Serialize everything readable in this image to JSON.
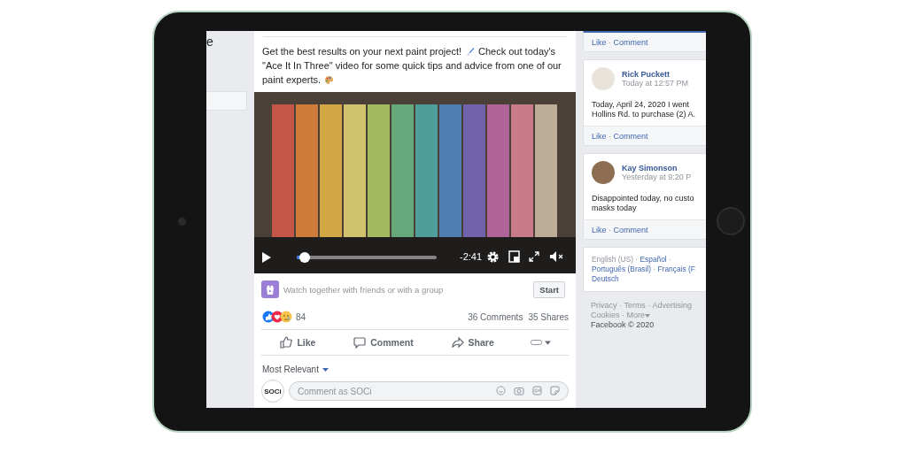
{
  "left_column": {
    "label": "e"
  },
  "separator": "·",
  "post": {
    "text_lines": [
      [
        {
          "kind": "text",
          "text": "Get the best results on your next paint project!"
        },
        {
          "kind": "brush"
        },
        {
          "kind": "text",
          "text": "Check out today's"
        }
      ],
      [
        {
          "kind": "text",
          "text": "\"Ace It In Three\" video for some quick tips and advice from one of our"
        }
      ],
      [
        {
          "kind": "text",
          "text": "paint experts."
        },
        {
          "kind": "palette"
        }
      ]
    ],
    "video": {
      "time": "-2:41",
      "progress": {
        "level": 0.06
      }
    },
    "watch_together": {
      "text": "Watch together with friends or with a group",
      "button": "Start"
    },
    "reactions": {
      "count": "84",
      "comments": "36 Comments",
      "shares": "35 Shares"
    },
    "actions": [
      {
        "kind": "like",
        "label": "Like"
      },
      {
        "kind": "comment",
        "label": "Comment"
      },
      {
        "kind": "share",
        "label": "Share"
      }
    ],
    "sort": {
      "label": "Most Relevant"
    },
    "comment_box": {
      "avatar": "SOCi",
      "placeholder": "Comment as SOCi"
    }
  },
  "reviews": [
    {
      "links": [
        "Like",
        "Comment"
      ]
    },
    {
      "name": "Rick Puckett",
      "time": "Today at 12:57 PM",
      "lines": [
        "Today, April 24, 2020 I went",
        "Hollins Rd. to purchase (2) A."
      ],
      "links": [
        "Like",
        "Comment"
      ]
    },
    {
      "name": "Kay Simonson",
      "time": "Yesterday at 9:20 P",
      "lines": [
        "Disappointed today, no custo",
        "masks today"
      ],
      "links": [
        "Like",
        "Comment"
      ]
    }
  ],
  "languages": [
    {
      "label": "English (US)",
      "kind": "current"
    },
    {
      "label": "Español",
      "kind": "link"
    },
    {
      "label": "Português (Brasil)",
      "kind": "link"
    },
    {
      "label": "Français (F",
      "kind": "link"
    },
    {
      "label": "Deutsch",
      "kind": "link"
    }
  ],
  "footer_links": [
    "Privacy",
    "Terms",
    "Advertising",
    "Cookies",
    "More"
  ],
  "copyright": "Facebook © 2020"
}
